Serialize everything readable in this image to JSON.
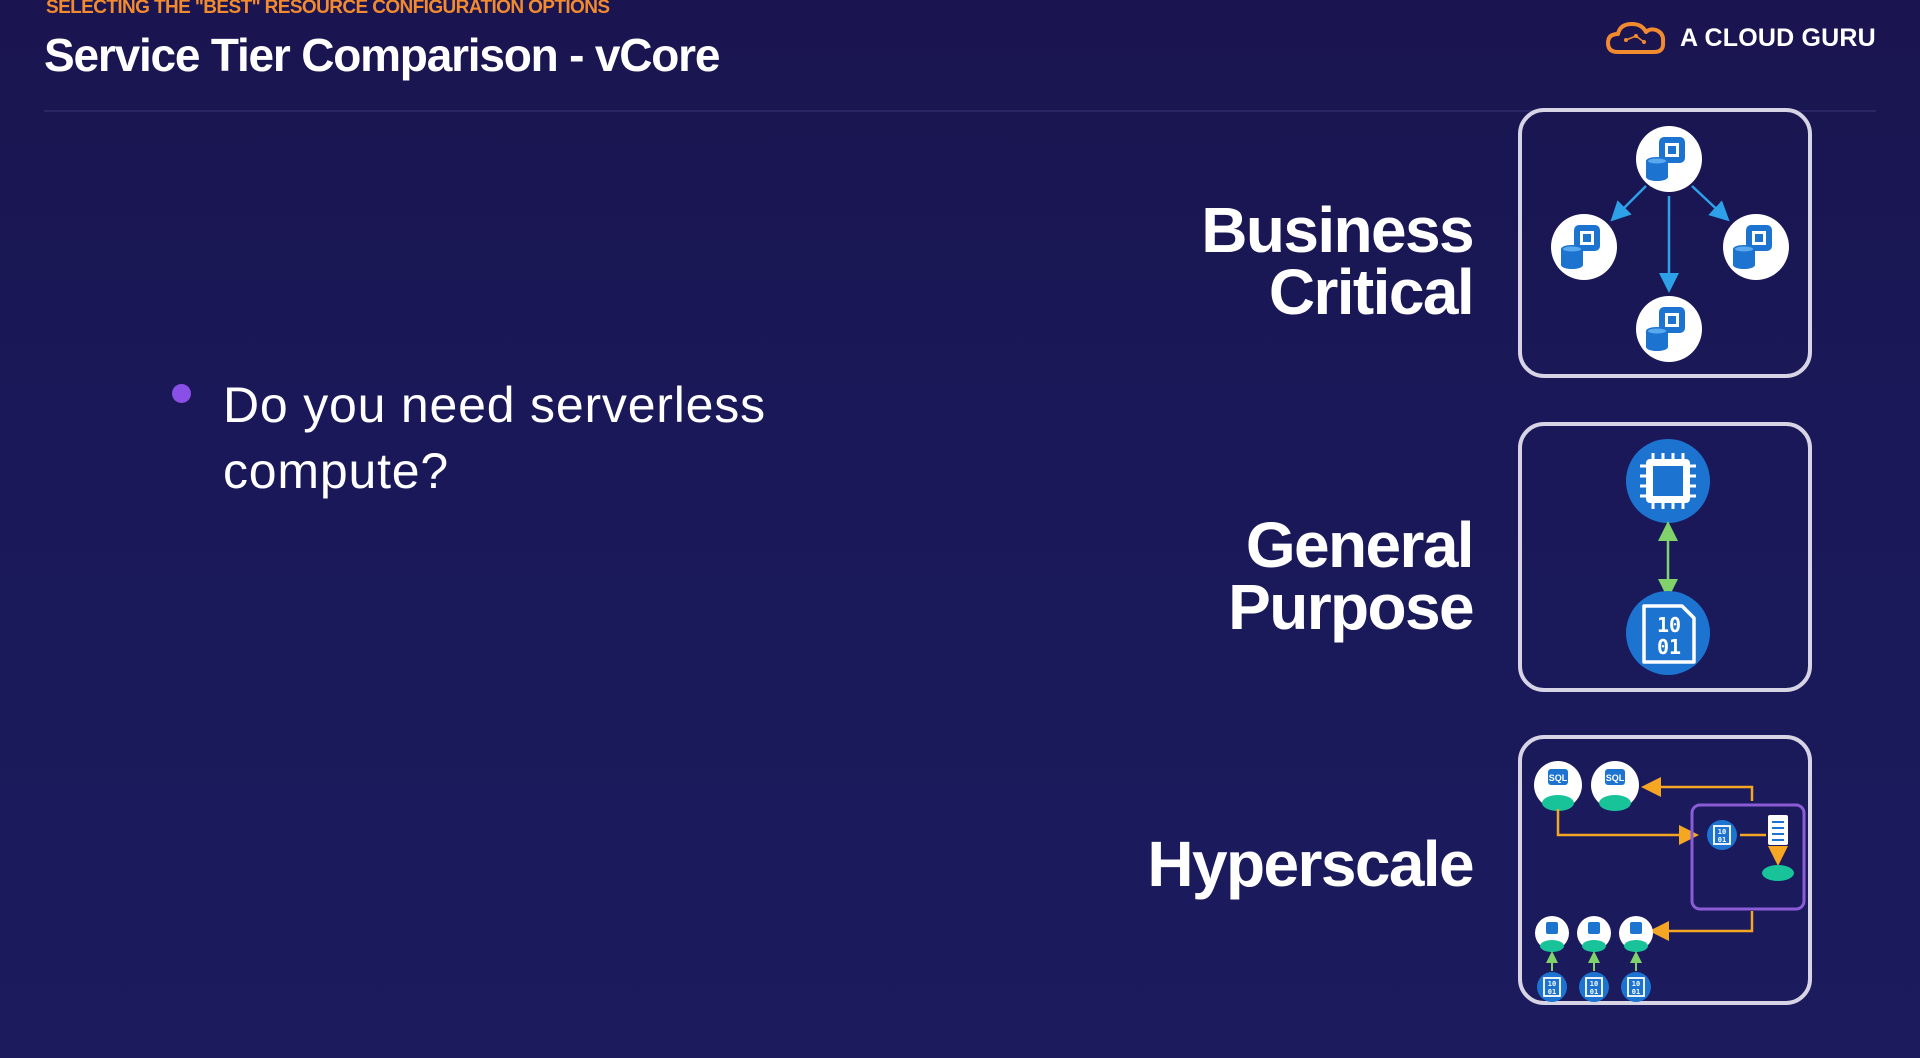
{
  "header": {
    "eyebrow": "SELECTING THE \"BEST\" RESOURCE CONFIGURATION OPTIONS",
    "title": "Service Tier Comparison - vCore"
  },
  "brand": {
    "name": "A CLOUD GURU",
    "logo_icon": "cloud-icon",
    "accent": "#f28a2f"
  },
  "bullets": [
    {
      "text": "Do you need serverless compute?"
    }
  ],
  "tiers": [
    {
      "label_line1": "Business",
      "label_line2": "Critical",
      "diagram_icon": "replicated-database-icon"
    },
    {
      "label_line1": "General",
      "label_line2": "Purpose",
      "diagram_icon": "compute-storage-icon"
    },
    {
      "label_line1": "Hyperscale",
      "label_line2": "",
      "diagram_icon": "hyperscale-architecture-icon"
    }
  ],
  "diagram_text": {
    "sql": "SQL",
    "binary_top": "10",
    "binary_bottom": "01"
  },
  "colors": {
    "background": "#1a1858",
    "bullet": "#8a4fe6",
    "azure_blue": "#1c74d0",
    "arrow_blue": "#2ea0e8",
    "arrow_green": "#7fd36a",
    "arrow_orange": "#f5a623",
    "teal": "#19c39a",
    "purple_box": "#8c5bd6"
  }
}
